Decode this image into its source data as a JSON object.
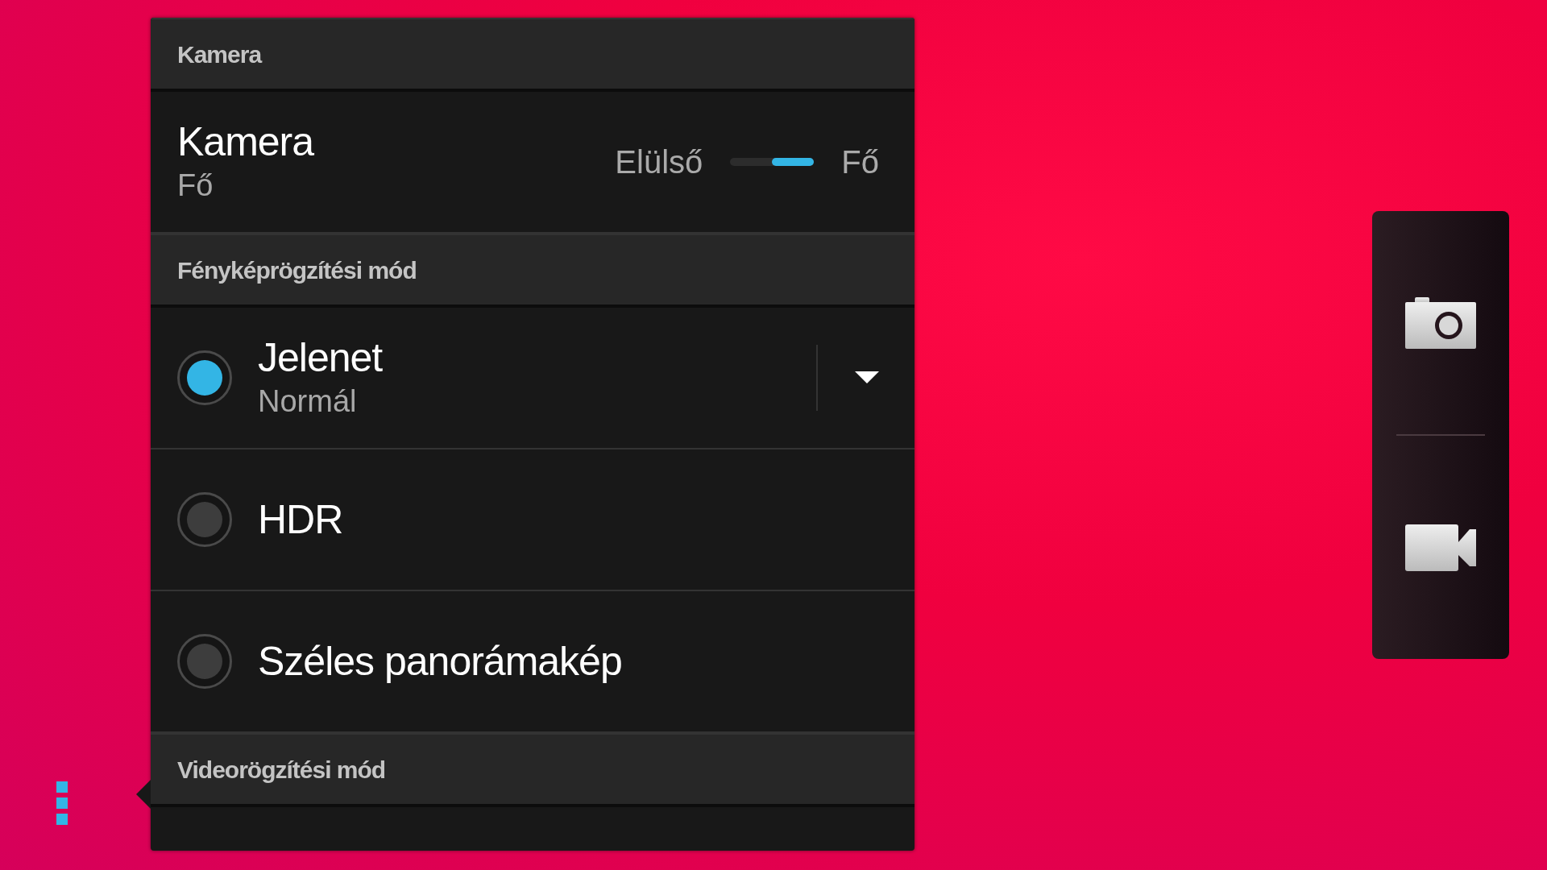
{
  "sections": [
    {
      "title": "Kamera",
      "items": [
        {
          "kind": "switch",
          "title": "Kamera",
          "subtitle": "Fő",
          "left_label": "Elülső",
          "right_label": "Fő",
          "on": true
        }
      ]
    },
    {
      "title": "Fényképrögzítési mód",
      "items": [
        {
          "kind": "radio",
          "title": "Jelenet",
          "subtitle": "Normál",
          "selected": true,
          "expandable": true
        },
        {
          "kind": "radio",
          "title": "HDR",
          "selected": false,
          "expandable": false
        },
        {
          "kind": "radio",
          "title": "Széles panorámakép",
          "selected": false,
          "expandable": false
        }
      ]
    },
    {
      "title": "Videorögzítési mód"
    }
  ]
}
